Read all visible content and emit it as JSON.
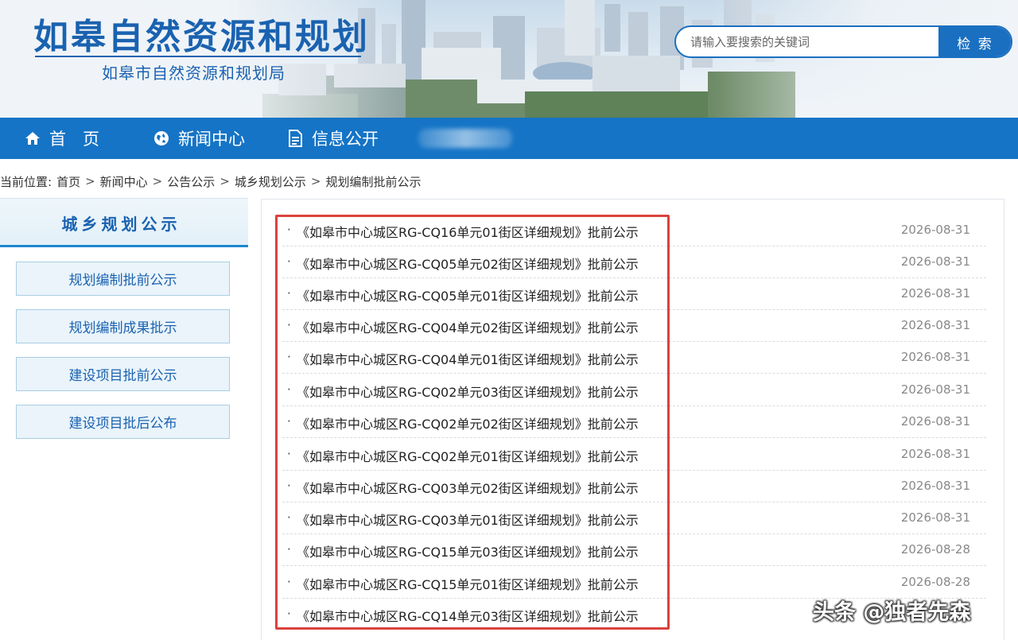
{
  "header": {
    "site_title": "如皋自然资源和规划",
    "site_subtitle": "如皋市自然资源和规划局",
    "search": {
      "placeholder": "请输入要搜索的关键词",
      "button_label": "检 索"
    }
  },
  "nav": {
    "items": [
      {
        "label": "首　页",
        "icon": "home-icon"
      },
      {
        "label": "新闻中心",
        "icon": "globe-icon"
      },
      {
        "label": "信息公开",
        "icon": "document-icon"
      }
    ]
  },
  "breadcrumb": {
    "prefix": "当前位置:",
    "items": [
      "首页",
      "新闻中心",
      "公告公示",
      "城乡规划公示",
      "规划编制批前公示"
    ],
    "separator": ">"
  },
  "sidebar": {
    "title": "城乡规划公示",
    "items": [
      "规划编制批前公示",
      "规划编制成果批示",
      "建设项目批前公示",
      "建设项目批后公布"
    ]
  },
  "list": {
    "bullet": "·",
    "rows": [
      {
        "title": "《如皋市中心城区RG-CQ16单元01街区详细规划》批前公示",
        "date": "2026-08-31"
      },
      {
        "title": "《如皋市中心城区RG-CQ05单元02街区详细规划》批前公示",
        "date": "2026-08-31"
      },
      {
        "title": "《如皋市中心城区RG-CQ05单元01街区详细规划》批前公示",
        "date": "2026-08-31"
      },
      {
        "title": "《如皋市中心城区RG-CQ04单元02街区详细规划》批前公示",
        "date": "2026-08-31"
      },
      {
        "title": "《如皋市中心城区RG-CQ04单元01街区详细规划》批前公示",
        "date": "2026-08-31"
      },
      {
        "title": "《如皋市中心城区RG-CQ02单元03街区详细规划》批前公示",
        "date": "2026-08-31"
      },
      {
        "title": "《如皋市中心城区RG-CQ02单元02街区详细规划》批前公示",
        "date": "2026-08-31"
      },
      {
        "title": "《如皋市中心城区RG-CQ02单元01街区详细规划》批前公示",
        "date": "2026-08-31"
      },
      {
        "title": "《如皋市中心城区RG-CQ03单元02街区详细规划》批前公示",
        "date": "2026-08-31"
      },
      {
        "title": "《如皋市中心城区RG-CQ03单元01街区详细规划》批前公示",
        "date": "2026-08-31"
      },
      {
        "title": "《如皋市中心城区RG-CQ15单元03街区详细规划》批前公示",
        "date": "2026-08-28"
      },
      {
        "title": "《如皋市中心城区RG-CQ15单元01街区详细规划》批前公示",
        "date": "2026-08-28"
      },
      {
        "title": "《如皋市中心城区RG-CQ14单元03街区详细规划》批前公示",
        "date": ""
      }
    ]
  },
  "watermark": "头条 @独者先森",
  "colors": {
    "brand_blue": "#1574c6",
    "title_blue": "#1a62b0",
    "highlight_red": "#d9423d"
  }
}
